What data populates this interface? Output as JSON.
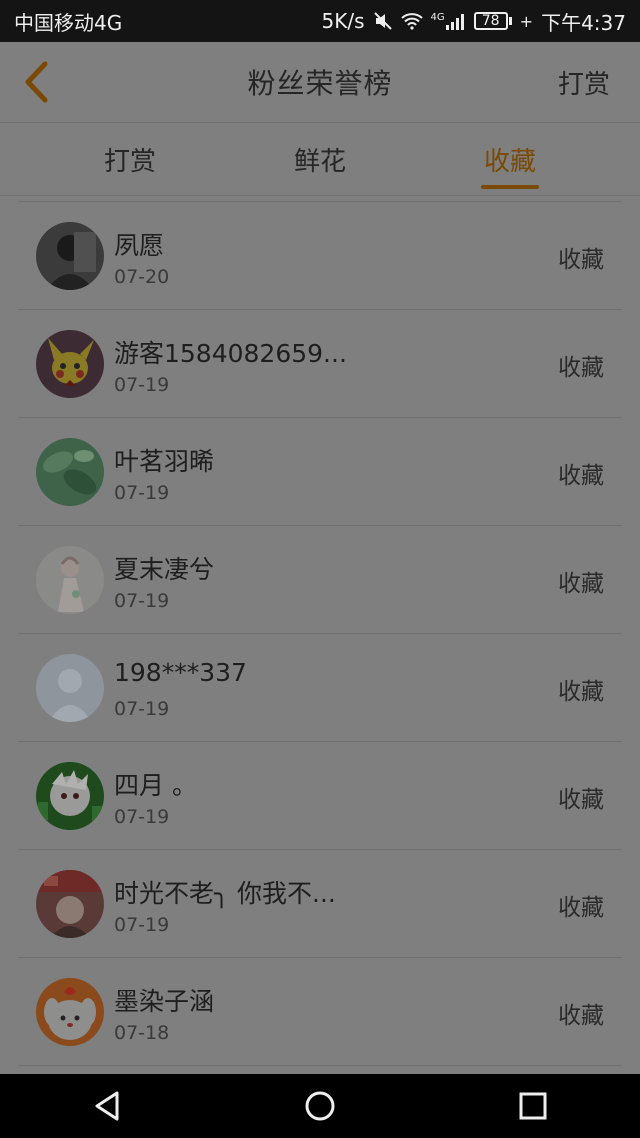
{
  "status_bar": {
    "carrier": "中国移动4G",
    "speed": "5K/s",
    "signal_label": "4G",
    "battery": "78",
    "time": "下午4:37",
    "icons": [
      "mute-icon",
      "wifi-icon",
      "signal-icon",
      "battery-icon",
      "charging-icon"
    ]
  },
  "header": {
    "title": "粉丝荣誉榜",
    "action": "打赏",
    "back_icon": "chevron-left-icon"
  },
  "tabs": [
    {
      "label": "打赏",
      "active": false
    },
    {
      "label": "鲜花",
      "active": false
    },
    {
      "label": "收藏",
      "active": true
    }
  ],
  "colors": {
    "accent": "#7a4a05",
    "overlay_bg": "#7f7f7f",
    "status_bar_bg": "#141414"
  },
  "fans": [
    {
      "name": "夙愿",
      "date": "07-20",
      "action": "收藏"
    },
    {
      "name": "游客1584082659...",
      "date": "07-19",
      "action": "收藏"
    },
    {
      "name": "叶茗羽晞",
      "date": "07-19",
      "action": "收藏"
    },
    {
      "name": "夏末凄兮",
      "date": "07-19",
      "action": "收藏"
    },
    {
      "name": "198***337",
      "date": "07-19",
      "action": "收藏"
    },
    {
      "name": "四月 。",
      "date": "07-19",
      "action": "收藏"
    },
    {
      "name": "时光不老╮ 你我不...",
      "date": "07-19",
      "action": "收藏"
    },
    {
      "name": "墨染子涵",
      "date": "07-18",
      "action": "收藏"
    }
  ],
  "system_nav": {
    "buttons": [
      "back-triangle-icon",
      "home-circle-icon",
      "recents-square-icon"
    ]
  }
}
